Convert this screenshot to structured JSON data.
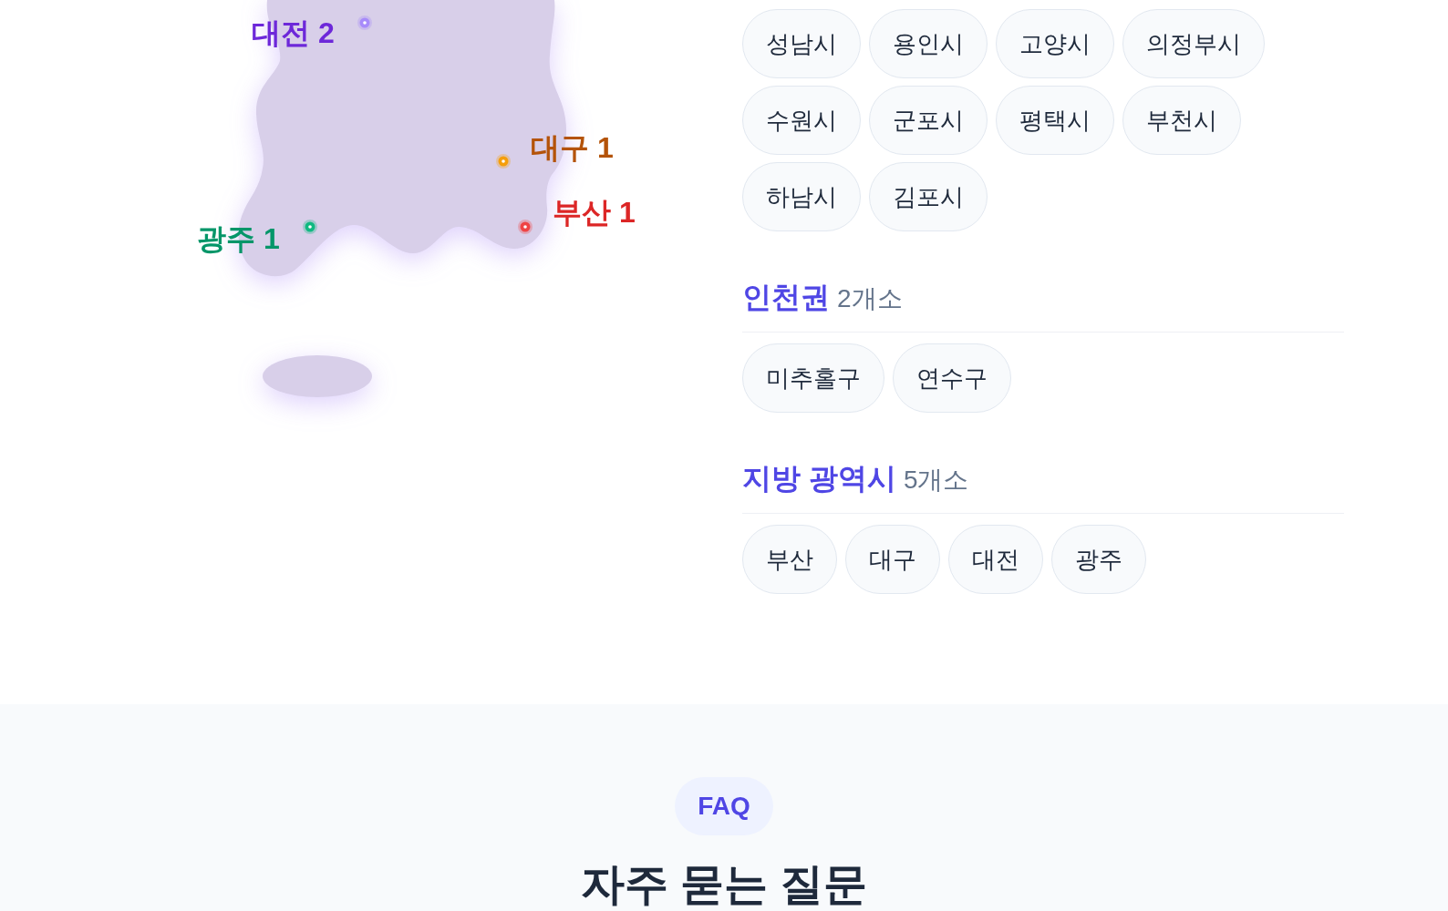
{
  "coverage_map": {
    "pins": [
      {
        "dot": {
          "color": "#a78bfa"
        },
        "label": {
          "text": "대전 2",
          "color": "#6d28d9"
        }
      },
      {
        "dot": {
          "color": "#f59e0b"
        },
        "label": {
          "text": "대구 1",
          "color": "#b45309"
        }
      },
      {
        "dot": {
          "color": "#ef4444"
        },
        "label": {
          "text": "부산 1",
          "color": "#dc2626"
        }
      },
      {
        "dot": {
          "color": "#10b981"
        },
        "label": {
          "text": "광주 1",
          "color": "#059669"
        }
      }
    ]
  },
  "region_groups": [
    {
      "chips": [
        "성남시",
        "용인시",
        "고양시",
        "의정부시",
        "수원시",
        "군포시",
        "평택시",
        "부천시",
        "하남시",
        "김포시"
      ]
    },
    {
      "title": "인천권",
      "count": "2개소",
      "chips": [
        "미추홀구",
        "연수구"
      ]
    },
    {
      "title": "지방 광역시",
      "count": "5개소",
      "chips": [
        "부산",
        "대구",
        "대전",
        "광주"
      ]
    }
  ],
  "faq": {
    "badge": "FAQ",
    "title": "자주 묻는 질문"
  }
}
